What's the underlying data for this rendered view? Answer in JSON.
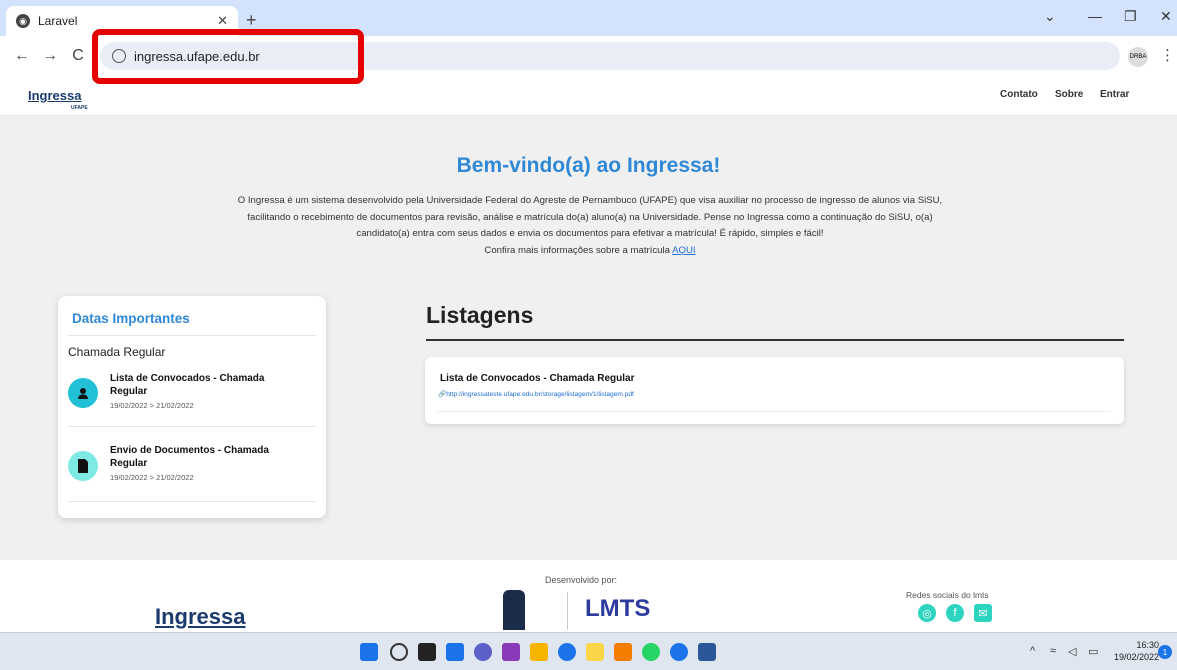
{
  "browser": {
    "tab_title": "Laravel",
    "url": "ingressa.ufape.edu.br",
    "new_tab": "+",
    "profile_label": "DRBA"
  },
  "site": {
    "logo": "Ingressa",
    "logo_sub": "UFAPE",
    "nav": [
      "Contato",
      "Sobre",
      "Entrar"
    ]
  },
  "hero": {
    "title": "Bem-vindo(a) ao Ingressa!",
    "text": "O Ingressa é um sistema desenvolvido pela Universidade Federal do Agreste de Pernambuco (UFAPE) que visa auxiliar no processo de ingresso de alunos via SiSU, facilitando o recebimento de documentos para revisão, análise e matrícula do(a) aluno(a) na Universidade. Pense no Ingressa como a continuação do SiSU, o(a) candidato(a) entra com seus dados e envia os documentos para efetivar a matrícula! É rápido, simples e fácil!",
    "more_info": "Confira mais informações sobre a matrícula ",
    "more_link": "AQUI"
  },
  "datas": {
    "title": "Datas Importantes",
    "subtitle": "Chamada Regular",
    "events": [
      {
        "title": "Lista de Convocados - Chamada Regular",
        "date": "19/02/2022 > 21/02/2022",
        "icon": "user-icon"
      },
      {
        "title": "Envio de Documentos - Chamada Regular",
        "date": "19/02/2022 > 21/02/2022",
        "icon": "document-icon"
      }
    ]
  },
  "listagens": {
    "title": "Listagens",
    "items": [
      {
        "title": "Lista de Convocados - Chamada Regular",
        "link": "http://ingressateste.ufape.edu.br/storage/listagem/1/listagem.pdf"
      }
    ]
  },
  "footer": {
    "logo": "Ingressa",
    "developed_by": "Desenvolvido por:",
    "lmts": "LMTS",
    "social_title": "Redes sociais do lmts",
    "social_icons": [
      "instagram-icon",
      "facebook-icon",
      "email-icon"
    ]
  },
  "taskbar": {
    "time": "16:30",
    "date": "19/02/2022",
    "notifications": "1"
  },
  "colors": {
    "accent": "#2f88d6",
    "teal": "#2dd4bf",
    "highlight": "#e60000"
  }
}
